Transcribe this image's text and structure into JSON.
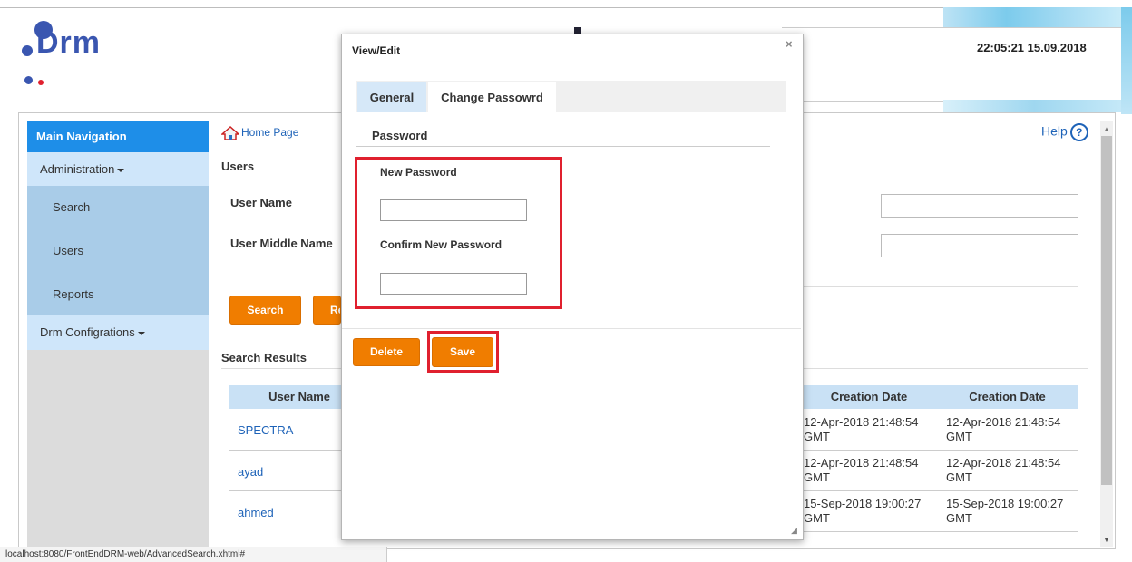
{
  "header": {
    "logo_text": "Drm",
    "datetime": "22:05:21 15.09.2018"
  },
  "breadcrumb": {
    "home": "Home Page"
  },
  "help": {
    "label": "Help",
    "icon": "?"
  },
  "sidebar": {
    "title": "Main Navigation",
    "administration": "Administration",
    "items": [
      "Search",
      "Users",
      "Reports"
    ],
    "drm_config": "Drm Configrations"
  },
  "users_section": {
    "title": "Users",
    "user_name_label": "User Name",
    "user_middle_name_label": "User Middle Name",
    "search_button": "Search",
    "reset_button_partial": "Re"
  },
  "results": {
    "title": "Search Results",
    "columns": [
      "User Name",
      "Creation Date",
      "Creation Date"
    ],
    "rows": [
      {
        "user": "SPECTRA",
        "date1": "12-Apr-2018 21:48:54 GMT",
        "date2": "12-Apr-2018 21:48:54 GMT"
      },
      {
        "user": "ayad",
        "date1": "12-Apr-2018 21:48:54 GMT",
        "date2": "12-Apr-2018 21:48:54 GMT"
      },
      {
        "user": "ahmed",
        "date1": "15-Sep-2018 19:00:27 GMT",
        "date2": "15-Sep-2018 19:00:27 GMT"
      }
    ]
  },
  "status_bar": "localhost:8080/FrontEndDRM-web/AdvancedSearch.xhtml#",
  "modal": {
    "title": "View/Edit",
    "close": "×",
    "tabs": [
      "General",
      "Change Passowrd"
    ],
    "section": "Password",
    "new_password_label": "New Password",
    "confirm_password_label": "Confirm New Password",
    "delete_button": "Delete",
    "save_button": "Save"
  },
  "colors": {
    "accent_orange": "#f07d00",
    "nav_blue": "#1e8ee8",
    "highlight_red": "#e0202e"
  }
}
